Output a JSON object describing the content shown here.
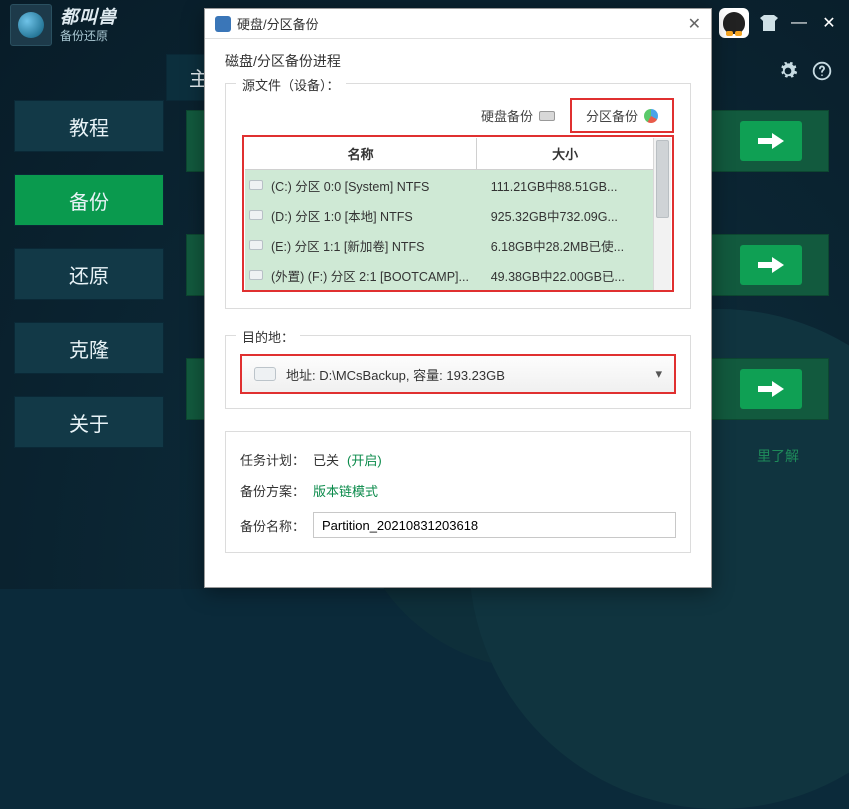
{
  "app": {
    "title": "都叫兽",
    "subtitle": "备份还原"
  },
  "titlebar": {
    "min_symbol": "—",
    "close_symbol": "✕"
  },
  "main_tab": "主",
  "sidebar": {
    "items": [
      {
        "label": "教程"
      },
      {
        "label": "备份"
      },
      {
        "label": "还原"
      },
      {
        "label": "克隆"
      },
      {
        "label": "关于"
      }
    ]
  },
  "link_more": "里了解",
  "dialog": {
    "title": "硬盘/分区备份",
    "section_title": "磁盘/分区备份进程",
    "source_label": "源文件（设备）：",
    "tabs": {
      "disk": "硬盘备份",
      "partition": "分区备份"
    },
    "columns": {
      "name": "名称",
      "size": "大小"
    },
    "rows": [
      {
        "name": "(C:) 分区 0:0 [System] NTFS",
        "size": "111.21GB中88.51GB..."
      },
      {
        "name": "(D:) 分区 1:0 [本地] NTFS",
        "size": "925.32GB中732.09G..."
      },
      {
        "name": "(E:) 分区 1:1 [新加卷] NTFS",
        "size": "6.18GB中28.2MB已使..."
      },
      {
        "name": "(外置)  (F:) 分区 2:1 [BOOTCAMP]...",
        "size": "49.38GB中22.00GB已..."
      }
    ],
    "dest": {
      "legend": "目的地：",
      "value": "地址: D:\\MCsBackup, 容量: 193.23GB"
    },
    "task": {
      "label": "任务计划：",
      "status": "已关",
      "toggle": "(开启)"
    },
    "scheme": {
      "label": "备份方案：",
      "value": "版本链模式"
    },
    "backup_name": {
      "label": "备份名称：",
      "value": "Partition_20210831203618"
    }
  }
}
